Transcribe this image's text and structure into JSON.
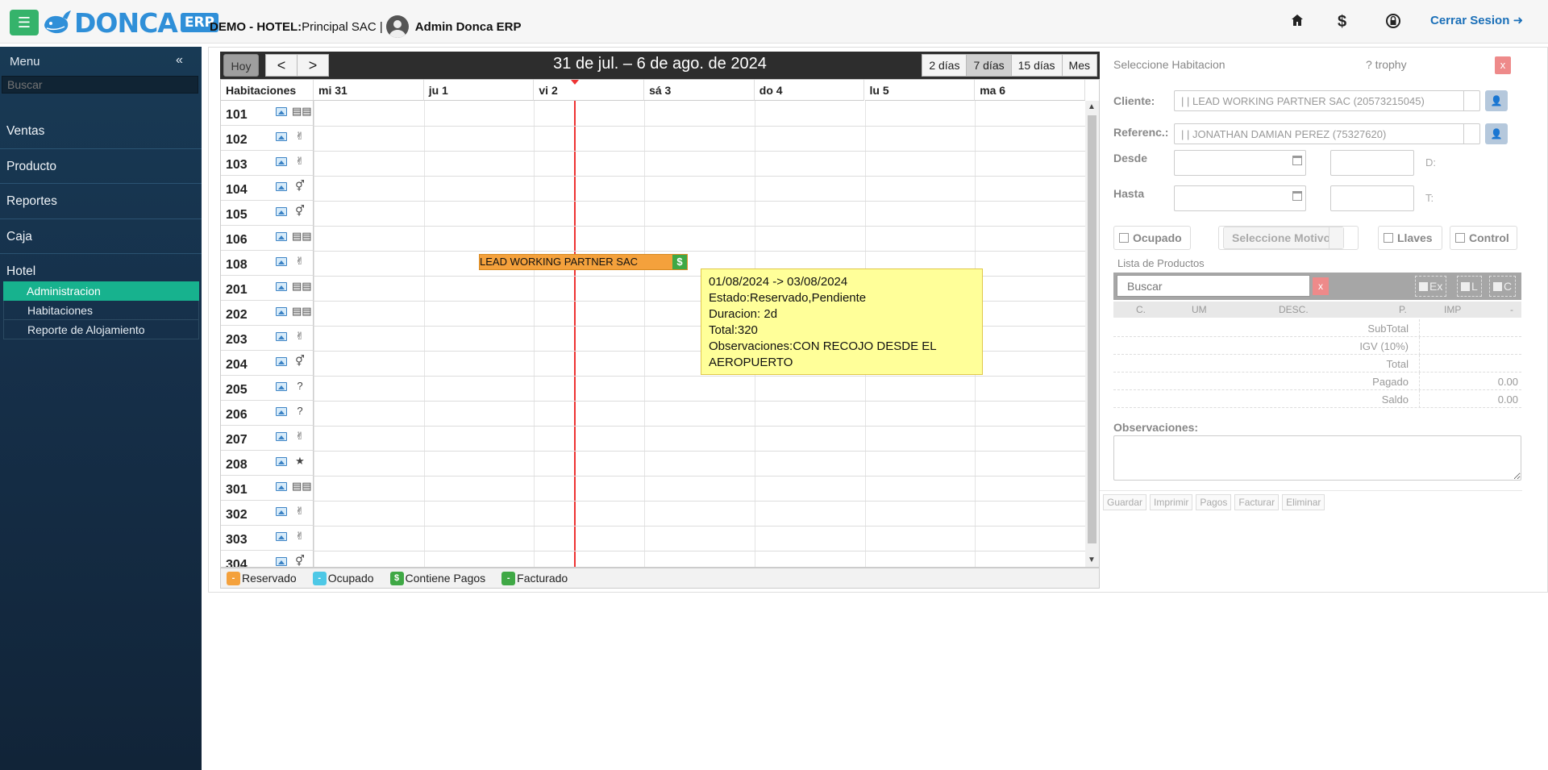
{
  "header": {
    "logo_text": "DONCA",
    "logo_badge": "ERP",
    "company_prefix": "DEMO - HOTEL:",
    "company_name": " Principal SAC |",
    "user": "Admin Donca ERP",
    "logout_label": "Cerrar Sesion",
    "icons": [
      "home-icon",
      "dollar-icon",
      "lock-icon",
      "logout-icon"
    ]
  },
  "sidebar": {
    "title": "Menu",
    "search_placeholder": "Buscar",
    "items": [
      {
        "label": "Ventas"
      },
      {
        "label": "Producto"
      },
      {
        "label": "Reportes"
      },
      {
        "label": "Caja"
      },
      {
        "label": "Hotel"
      }
    ],
    "sub_items": [
      {
        "label": "Administracion",
        "active": true
      },
      {
        "label": "Habitaciones"
      },
      {
        "label": "Reporte de Alojamiento"
      }
    ]
  },
  "calendar": {
    "today_label": "Hoy",
    "prev_label": "<",
    "next_label": ">",
    "title": "31 de jul. – 6 de ago. de 2024",
    "views": [
      {
        "label": "2 días"
      },
      {
        "label": "7 días",
        "active": true
      },
      {
        "label": "15 días"
      },
      {
        "label": "Mes"
      }
    ],
    "rooms_header": "Habitaciones",
    "days": [
      "mi 31",
      "ju 1",
      "vi 2",
      "sá 3",
      "do 4",
      "lu 5",
      "ma 6"
    ],
    "rooms": [
      {
        "num": "101",
        "type": "bed"
      },
      {
        "num": "102",
        "type": "peace"
      },
      {
        "num": "103",
        "type": "peace"
      },
      {
        "num": "104",
        "type": "gender"
      },
      {
        "num": "105",
        "type": "gender"
      },
      {
        "num": "106",
        "type": "bed"
      },
      {
        "num": "108",
        "type": "peace"
      },
      {
        "num": "201",
        "type": "bed"
      },
      {
        "num": "202",
        "type": "bed"
      },
      {
        "num": "203",
        "type": "peace"
      },
      {
        "num": "204",
        "type": "gender"
      },
      {
        "num": "205",
        "type": "question"
      },
      {
        "num": "206",
        "type": "question"
      },
      {
        "num": "207",
        "type": "peace"
      },
      {
        "num": "208",
        "type": "star"
      },
      {
        "num": "301",
        "type": "bed"
      },
      {
        "num": "302",
        "type": "peace"
      },
      {
        "num": "303",
        "type": "peace"
      },
      {
        "num": "304",
        "type": "gender"
      }
    ],
    "event": {
      "label": "LEAD WORKING PARTNER SAC",
      "pay_symbol": "$",
      "room": "108"
    },
    "tooltip": {
      "dates": "01/08/2024 -> 03/08/2024",
      "estado": "Estado:Reservado,Pendiente",
      "duracion": "Duracion: 2d",
      "total": "Total:320",
      "observaciones": "Observaciones:CON RECOJO DESDE EL AEROPUERTO"
    },
    "legend": [
      {
        "symbol": "-",
        "label": "Reservado",
        "color": "#f4a13c"
      },
      {
        "symbol": "-",
        "label": "Ocupado",
        "color": "#4dc8e6"
      },
      {
        "symbol": "$",
        "label": "Contiene Pagos",
        "color": "#3fa845"
      },
      {
        "symbol": "-",
        "label": "Facturado",
        "color": "#3fa845"
      }
    ]
  },
  "panel": {
    "title": "Seleccione Habitacion",
    "trophy": "? trophy",
    "close": "x",
    "cliente_label": "Cliente:",
    "cliente_value": "| | LEAD WORKING PARTNER SAC (20573215045)",
    "referenc_label": "Referenc.:",
    "referenc_value": "| | JONATHAN DAMIAN PEREZ (75327620)",
    "desde_label": "Desde",
    "hasta_label": "Hasta",
    "d_label": "D:",
    "t_label": "T:",
    "ocupado_label": "Ocupado",
    "motivo_placeholder": "Seleccione Motivo",
    "llaves_label": "Llaves",
    "control_label": "Control",
    "productos_label": "Lista de Productos",
    "search_placeholder": "Buscar",
    "clear": "x",
    "opt_ex": "Ex",
    "opt_l": "L",
    "opt_c": "C",
    "columns": [
      "C.",
      "UM",
      "DESC.",
      "P.",
      "IMP",
      "-"
    ],
    "totals": [
      {
        "label": "SubTotal",
        "value": ""
      },
      {
        "label": "IGV (10%)",
        "value": ""
      },
      {
        "label": "Total",
        "value": ""
      },
      {
        "label": "Pagado",
        "value": "0.00"
      },
      {
        "label": "Saldo",
        "value": "0.00"
      }
    ],
    "obs_label": "Observaciones:",
    "actions": [
      "Guardar",
      "Imprimir",
      "Pagos",
      "Facturar",
      "Eliminar"
    ]
  }
}
